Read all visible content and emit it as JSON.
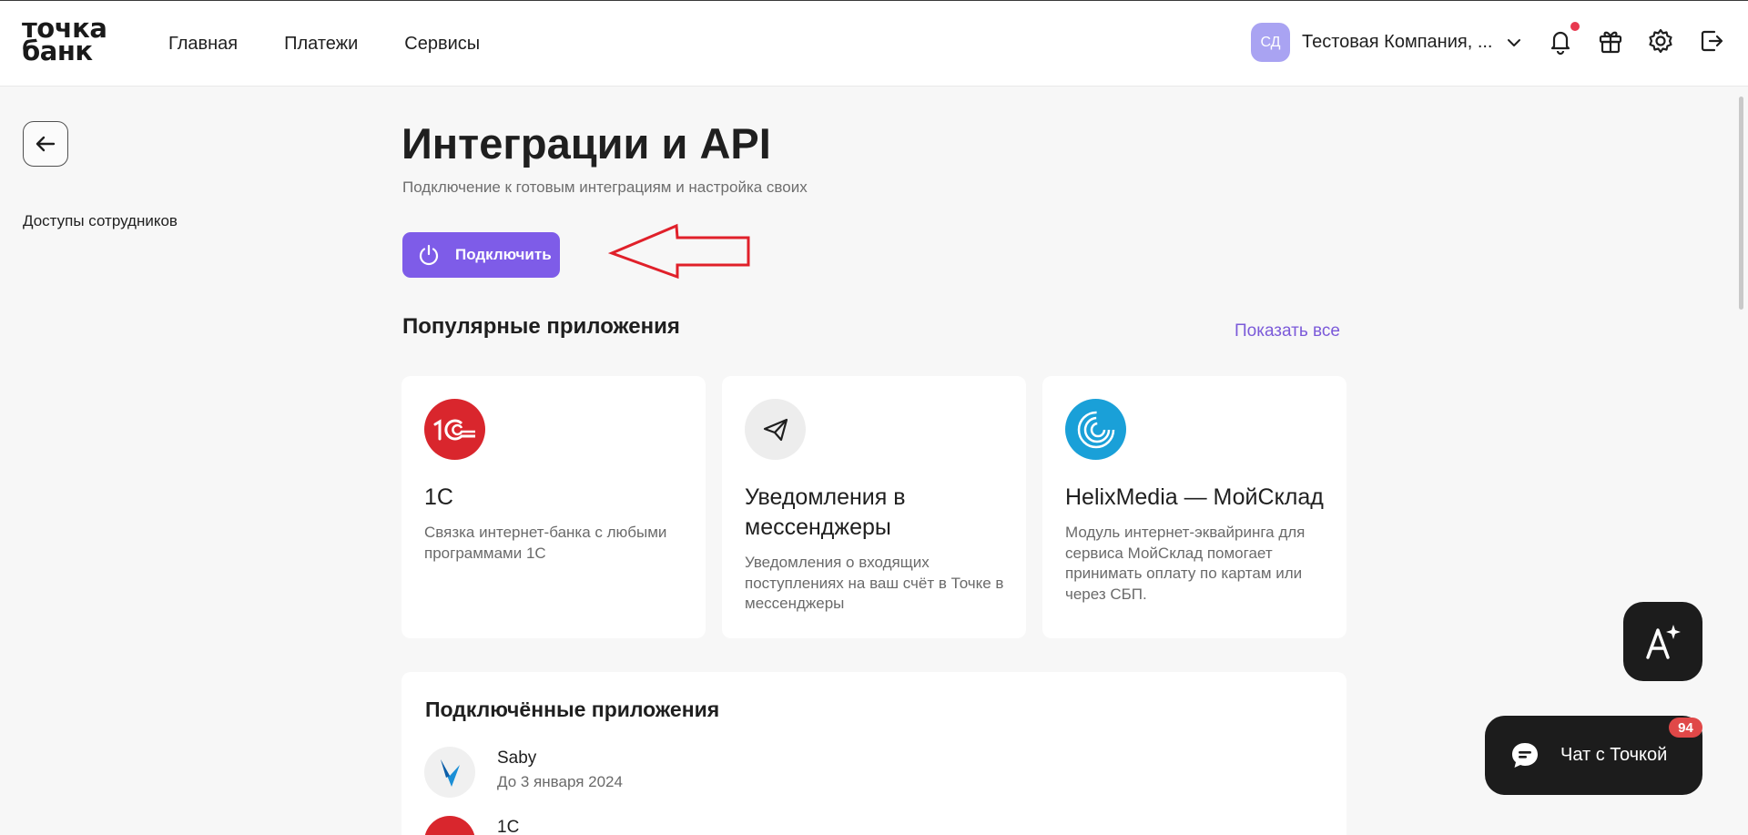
{
  "brand": {
    "logo_line1": "точка",
    "logo_line2": "банк"
  },
  "nav": {
    "items": [
      "Главная",
      "Платежи",
      "Сервисы"
    ]
  },
  "account": {
    "initials": "СД",
    "company": "Тестовая Компания, ..."
  },
  "header_icons": [
    "bell-icon",
    "gift-icon",
    "gear-icon",
    "logout-icon"
  ],
  "sidebar": {
    "links": [
      "Доступы сотрудников"
    ]
  },
  "page": {
    "title": "Интеграции и API",
    "subtitle": "Подключение к готовым интеграциям и настройка своих",
    "connect_label": "Подключить"
  },
  "popular": {
    "title": "Популярные приложения",
    "show_all": "Показать все",
    "cards": [
      {
        "title": "1С",
        "description": "Связка интернет-банка с любыми программами 1С"
      },
      {
        "title": "Уведомления в мессенджеры",
        "description": "Уведомления о входящих поступлениях на ваш счёт в Точке в мессенджеры"
      },
      {
        "title": "HelixMedia — МойСклад",
        "description": "Модуль интернет-эквайринга для сервиса МойСклад помогает принимать оплату по картам или через СБП."
      }
    ]
  },
  "connected": {
    "title": "Подключённые приложения",
    "items": [
      {
        "name": "Saby",
        "date": "До 3 января 2024"
      },
      {
        "name": "1С",
        "date": ""
      }
    ]
  },
  "chat": {
    "label": "Чат с Точкой",
    "badge": "94"
  },
  "colors": {
    "accent": "#7e5ce8",
    "link": "#7b5ad9",
    "annotation_arrow": "#e0202a",
    "onec_red": "#d9262d",
    "helix_blue": "#1aa0d8"
  }
}
